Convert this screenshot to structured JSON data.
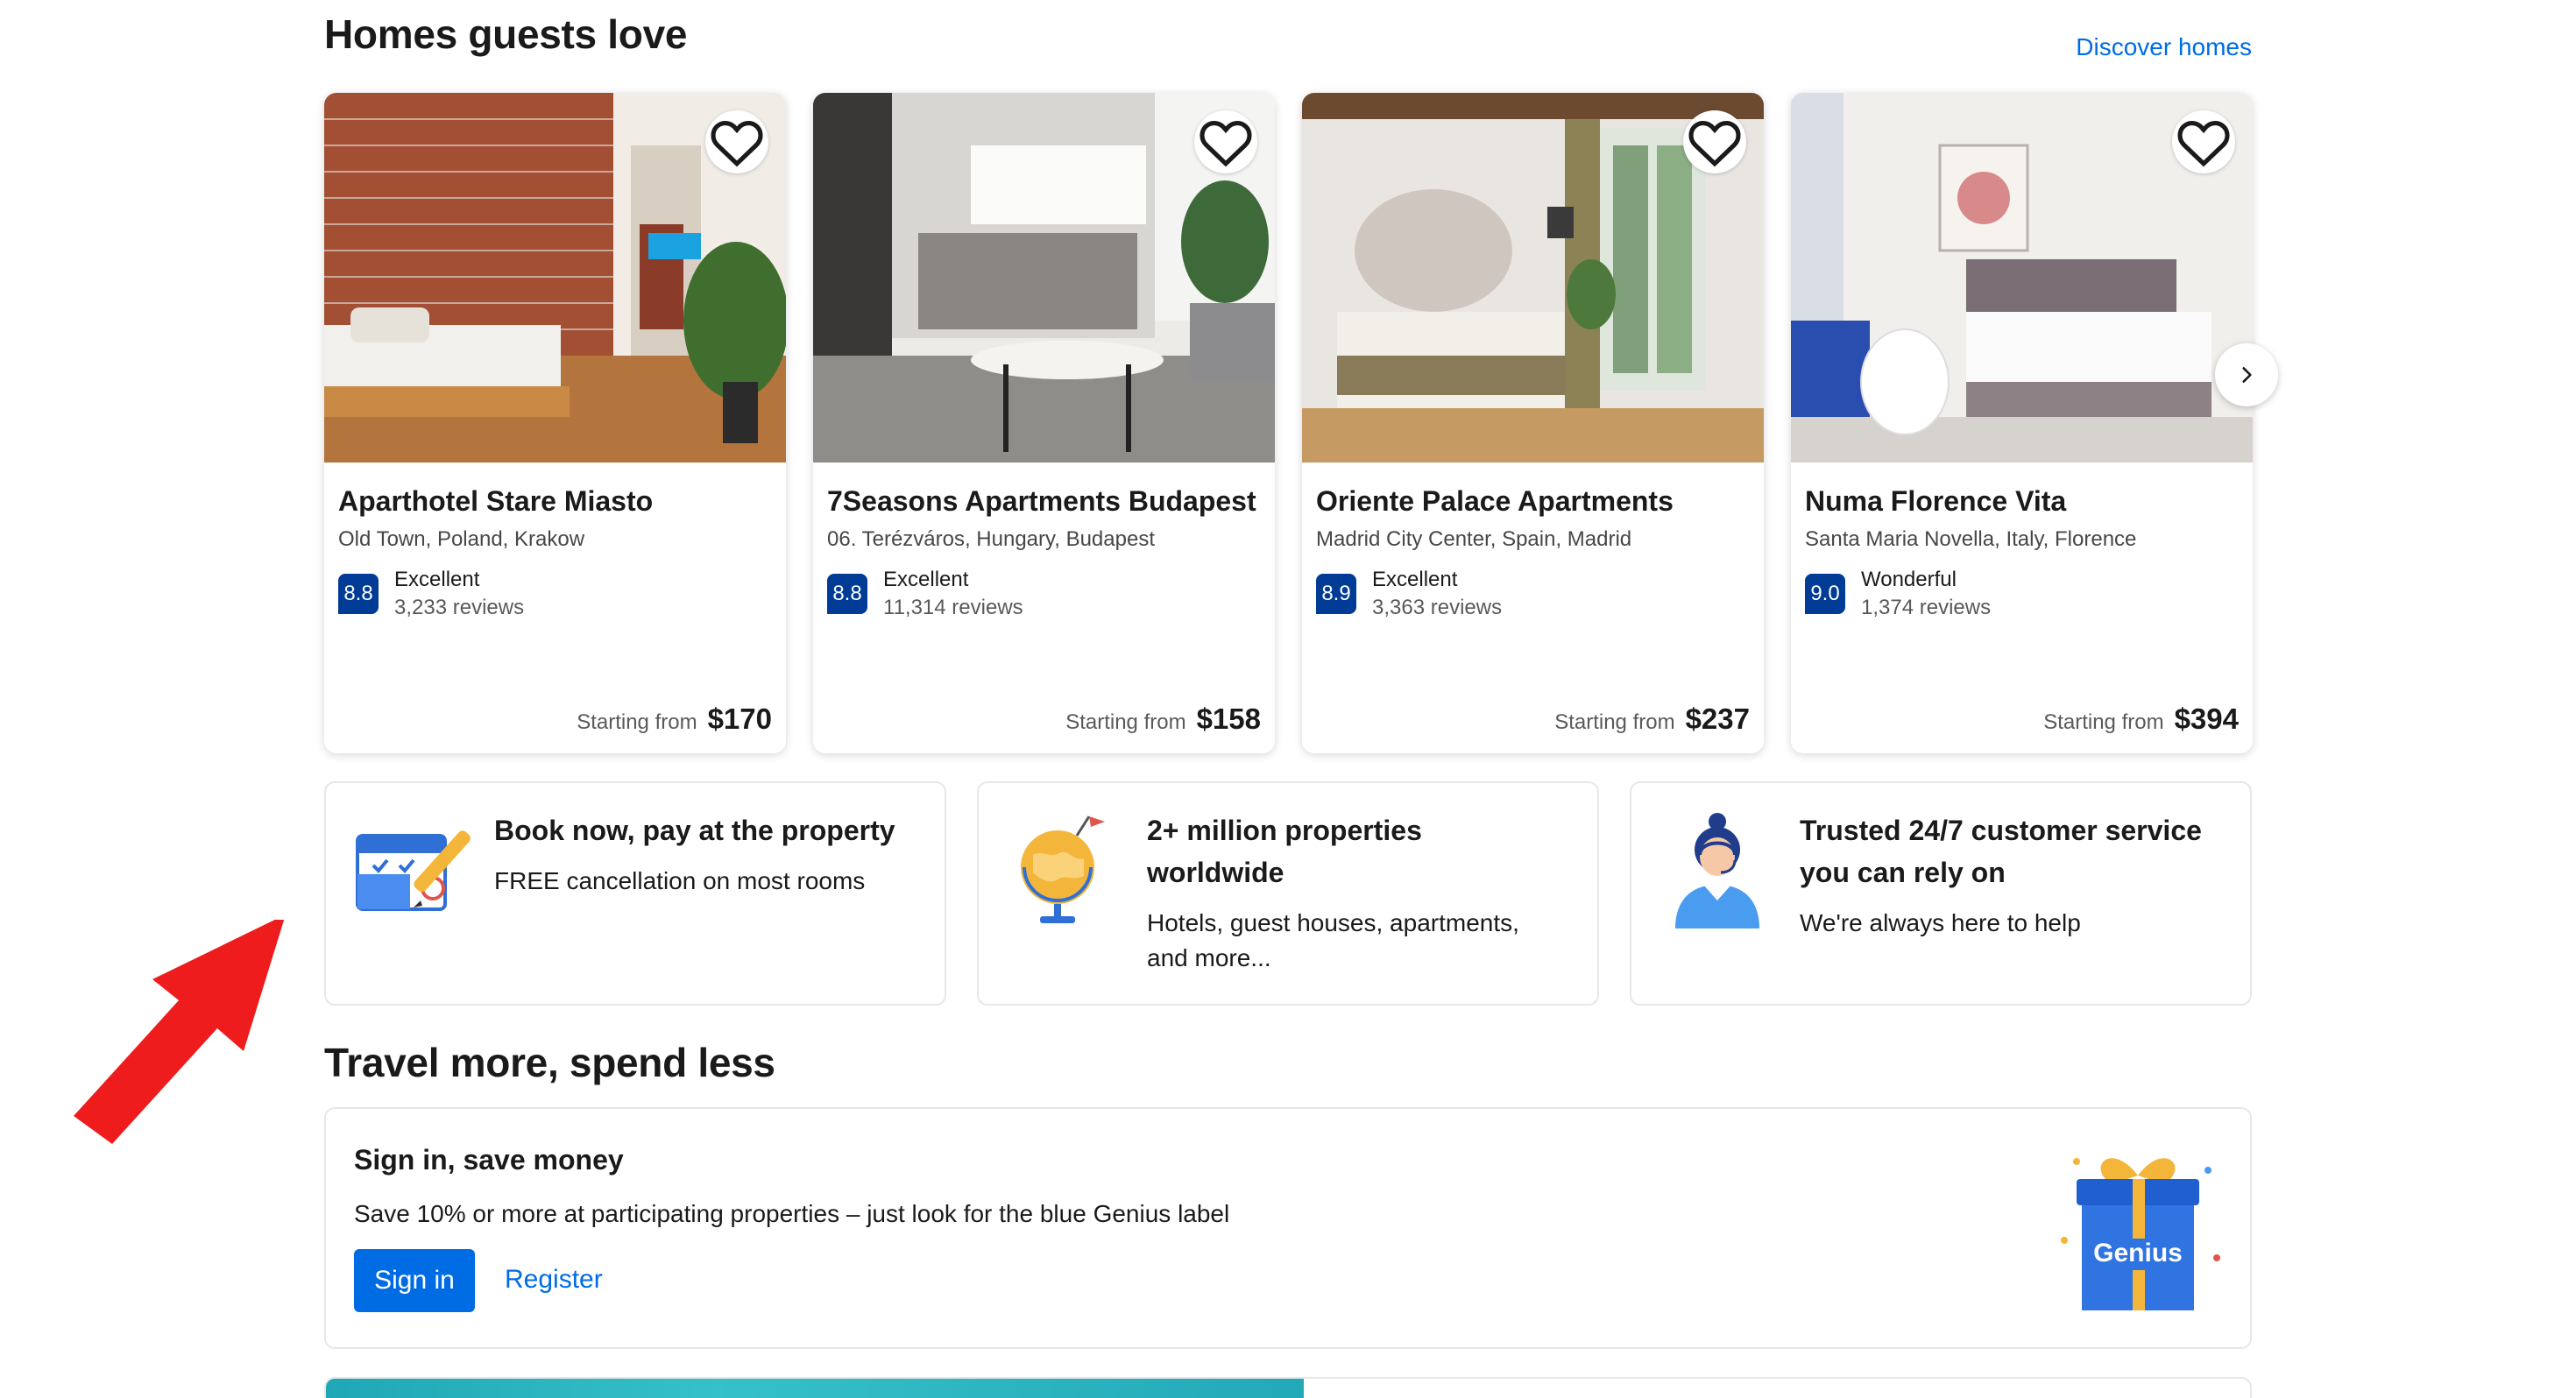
{
  "homes_section": {
    "title": "Homes guests love",
    "discover_link": "Discover homes",
    "properties": [
      {
        "name": "Aparthotel Stare Miasto",
        "location": "Old Town, Poland, Krakow",
        "score": "8.8",
        "rating_word": "Excellent",
        "reviews": "3,233 reviews",
        "price_label": "Starting from",
        "price": "$170"
      },
      {
        "name": "7Seasons Apartments Budapest",
        "location": "06. Terézváros, Hungary, Budapest",
        "score": "8.8",
        "rating_word": "Excellent",
        "reviews": "11,314 reviews",
        "price_label": "Starting from",
        "price": "$158"
      },
      {
        "name": "Oriente Palace Apartments",
        "location": "Madrid City Center, Spain, Madrid",
        "score": "8.9",
        "rating_word": "Excellent",
        "reviews": "3,363 reviews",
        "price_label": "Starting from",
        "price": "$237"
      },
      {
        "name": "Numa Florence Vita",
        "location": "Santa Maria Novella, Italy, Florence",
        "score": "9.0",
        "rating_word": "Wonderful",
        "reviews": "1,374 reviews",
        "price_label": "Starting from",
        "price": "$394"
      }
    ]
  },
  "features": [
    {
      "title": "Book now, pay at the property",
      "description": "FREE cancellation on most rooms",
      "icon": "calendar-icon"
    },
    {
      "title": "2+ million properties worldwide",
      "description": "Hotels, guest houses, apartments, and more...",
      "icon": "globe-icon"
    },
    {
      "title": "Trusted 24/7 customer service you can rely on",
      "description": "We're always here to help",
      "icon": "support-agent-icon"
    }
  ],
  "travel_section": {
    "title": "Travel more, spend less",
    "card_title": "Sign in, save money",
    "card_description": "Save 10% or more at participating properties – just look for the blue Genius label",
    "signin_label": "Sign in",
    "register_label": "Register",
    "gift_label": "Genius"
  },
  "colors": {
    "accent_blue": "#006ce4",
    "score_blue": "#003b95",
    "annotation_arrow": "#ee1c1c"
  }
}
